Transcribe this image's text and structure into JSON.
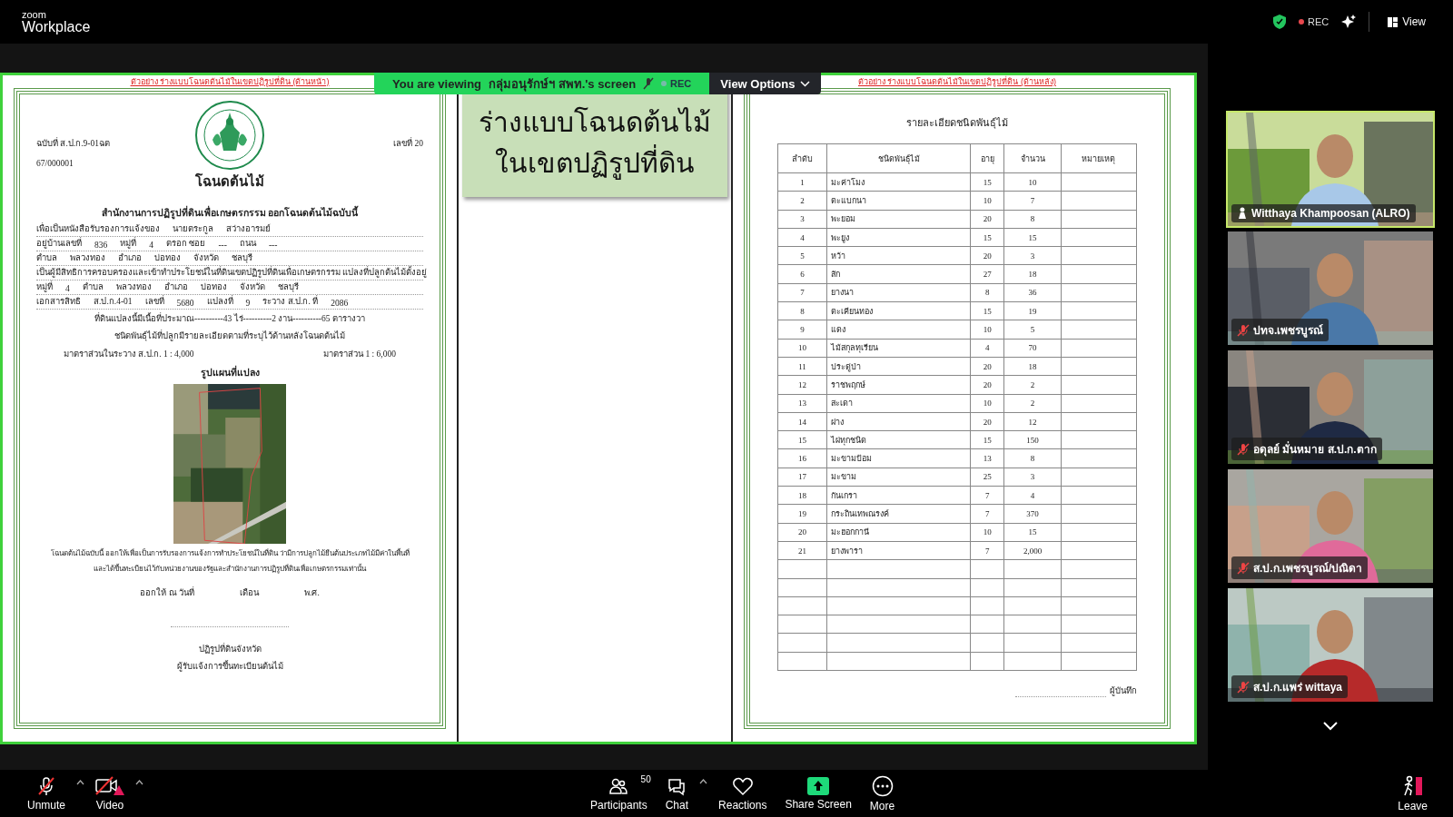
{
  "top_bar": {
    "brand_small": "zoom",
    "brand": "Workplace",
    "rec": "REC",
    "view": "View"
  },
  "banner": {
    "text": "You are viewing",
    "host": "กลุ่มอนุรักษ์ฯ สพท.'s screen",
    "rec": "REC",
    "view_options": "View Options"
  },
  "front_page": {
    "caption": "ตัวอย่าง ร่างแบบโฉนดต้นไม้ในเขตปฏิรูปที่ดิน (ด้านหน้า)",
    "edition": "ฉบับที่ ส.ป.ก.9-01ฉต",
    "serial": "67/000001",
    "number": "เลขที่ 20",
    "title": "โฉนดต้นไม้",
    "rows": [
      {
        "kind": "bold",
        "text": "สำนักงานการปฏิรูปที่ดินเพื่อเกษตรกรรม ออกโฉนดต้นไม้ฉบับนี้"
      },
      {
        "kind": "fields",
        "items": [
          "เพื่อเป็นหนังสือรับรองการแจ้งของ",
          "นายตระกูล",
          "สว่างอารมย์"
        ]
      },
      {
        "kind": "fields",
        "items": [
          "อยู่บ้านเลขที่",
          "836",
          "หมู่ที่",
          "4",
          "ตรอก ซอย",
          "---",
          "ถนน",
          "---"
        ]
      },
      {
        "kind": "fields",
        "items": [
          "ตำบล",
          "พลวงทอง",
          "อำเภอ",
          "บ่อทอง",
          "จังหวัด",
          "ชลบุรี"
        ]
      },
      {
        "kind": "fields",
        "items": [
          "เป็นผู้มีสิทธิการครอบครองและเข้าทำประโยชน์ในที่ดินเขตปฏิรูปที่ดินเพื่อเกษตรกรรม แปลงที่ปลูกต้นไม้ตั้งอยู่"
        ]
      },
      {
        "kind": "fields",
        "items": [
          "หมู่ที่",
          "4",
          "ตำบล",
          "พลวงทอง",
          "อำเภอ",
          "บ่อทอง",
          "จังหวัด",
          "ชลบุรี"
        ]
      },
      {
        "kind": "fields",
        "items": [
          "เอกสารสิทธิ",
          "ส.ป.ก.4-01",
          "เลขที่",
          "5680",
          "แปลงที่",
          "9",
          "ระวาง ส.ป.ก. ที่",
          "2086"
        ]
      },
      {
        "kind": "center",
        "text": "ที่ดินแปลงนี้มีเนื้อที่ประมาณ----------43 ไร่----------2 งาน----------65 ตารางวา"
      },
      {
        "kind": "center",
        "text": "ชนิดพันธุ์ไม้ที่ปลูกมีรายละเอียดตามที่ระบุไว้ด้านหลังโฉนดต้นไม้"
      },
      {
        "kind": "split",
        "items": [
          "มาตราส่วนในระวาง ส.ป.ก. 1 : 4,000",
          "มาตราส่วน 1 : 6,000"
        ]
      },
      {
        "kind": "heading",
        "text": "รูปแผนที่แปลง"
      },
      {
        "kind": "picture"
      },
      {
        "kind": "para",
        "text": "โฉนดต้นไม้ฉบับนี้ ออกให้เพื่อเป็นการรับรองการแจ้งการทำประโยชน์ในที่ดิน ว่ามีการปลูกไม้ยืนต้นประเภทไม้มีค่าในพื้นที่"
      },
      {
        "kind": "para",
        "text": "และได้ขึ้นทะเบียนไว้กับหน่วยงานของรัฐและสำนักงานการปฏิรูปที่ดินเพื่อเกษตรกรรมเท่านั้น"
      },
      {
        "kind": "date",
        "items": [
          "ออกให้ ณ วันที่",
          "เดือน",
          "พ.ศ."
        ]
      },
      {
        "kind": "signature"
      },
      {
        "kind": "center",
        "text": "ปฏิรูปที่ดินจังหวัด"
      },
      {
        "kind": "center",
        "text": "ผู้รับแจ้งการขึ้นทะเบียนต้นไม้"
      }
    ]
  },
  "slide": {
    "lines": [
      "ร่างแบบโฉนดต้นไม้",
      "ในเขตปฏิรูปที่ดิน"
    ]
  },
  "back_page": {
    "caption": "ตัวอย่าง ร่างแบบโฉนดต้นไม้ในเขตปฏิรูปที่ดิน (ด้านหลัง)",
    "title": "รายละเอียดชนิดพันธุ์ไม้",
    "columns": [
      "ลำดับ",
      "ชนิดพันธุ์ไม้",
      "อายุ",
      "จำนวน",
      "หมายเหตุ"
    ],
    "rows": [
      [
        "1",
        "มะค่าโมง",
        "15",
        "10"
      ],
      [
        "2",
        "ตะแบกนา",
        "10",
        "7"
      ],
      [
        "3",
        "พะยอม",
        "20",
        "8"
      ],
      [
        "4",
        "พะยูง",
        "15",
        "15"
      ],
      [
        "5",
        "หว้า",
        "20",
        "3"
      ],
      [
        "6",
        "สัก",
        "27",
        "18"
      ],
      [
        "7",
        "ยางนา",
        "8",
        "36"
      ],
      [
        "8",
        "ตะเคียนทอง",
        "15",
        "19"
      ],
      [
        "9",
        "แดง",
        "10",
        "5"
      ],
      [
        "10",
        "ไม้สกุลทุเรียน",
        "4",
        "70"
      ],
      [
        "11",
        "ประดู่ป่า",
        "20",
        "18"
      ],
      [
        "12",
        "ราชพฤกษ์",
        "20",
        "2"
      ],
      [
        "13",
        "สะเดา",
        "10",
        "2"
      ],
      [
        "14",
        "ฝาง",
        "20",
        "12"
      ],
      [
        "15",
        "ไผ่ทุกชนิด",
        "15",
        "150"
      ],
      [
        "16",
        "มะขามป้อม",
        "13",
        "8"
      ],
      [
        "17",
        "มะขาม",
        "25",
        "3"
      ],
      [
        "18",
        "กันเกรา",
        "7",
        "4"
      ],
      [
        "19",
        "กระถินเทพณรงค์",
        "7",
        "370"
      ],
      [
        "20",
        "มะฮอกกานี",
        "10",
        "15"
      ],
      [
        "21",
        "ยางพารา",
        "7",
        "2,000"
      ]
    ],
    "recorder": "ผู้บันทึก"
  },
  "participants": [
    {
      "name": "Witthaya Khampoosan (ALRO)",
      "speaking": true,
      "muted": false
    },
    {
      "name": "ปทจ.เพชรบูรณ์",
      "speaking": false,
      "muted": true
    },
    {
      "name": "อดุลย์ มั่นหมาย ส.ป.ก.ตาก",
      "speaking": false,
      "muted": true
    },
    {
      "name": "ส.ป.ก.เพชรบูรณ์/ปณิดา",
      "speaking": false,
      "muted": true
    },
    {
      "name": "ส.ป.ก.แพร่ wittaya",
      "speaking": false,
      "muted": true
    }
  ],
  "toolbar": [
    {
      "kind": "mic",
      "label": "Unmute",
      "caret": true
    },
    {
      "kind": "video",
      "label": "Video",
      "caret": true
    },
    {
      "kind": "participants",
      "label": "Participants",
      "count": "50",
      "caret": false
    },
    {
      "kind": "chat",
      "label": "Chat",
      "caret": true
    },
    {
      "kind": "reactions",
      "label": "Reactions",
      "caret": false
    },
    {
      "kind": "share",
      "label": "Share Screen",
      "caret": false
    },
    {
      "kind": "more",
      "label": "More",
      "caret": false
    },
    {
      "kind": "leave",
      "label": "Leave",
      "caret": false
    }
  ]
}
